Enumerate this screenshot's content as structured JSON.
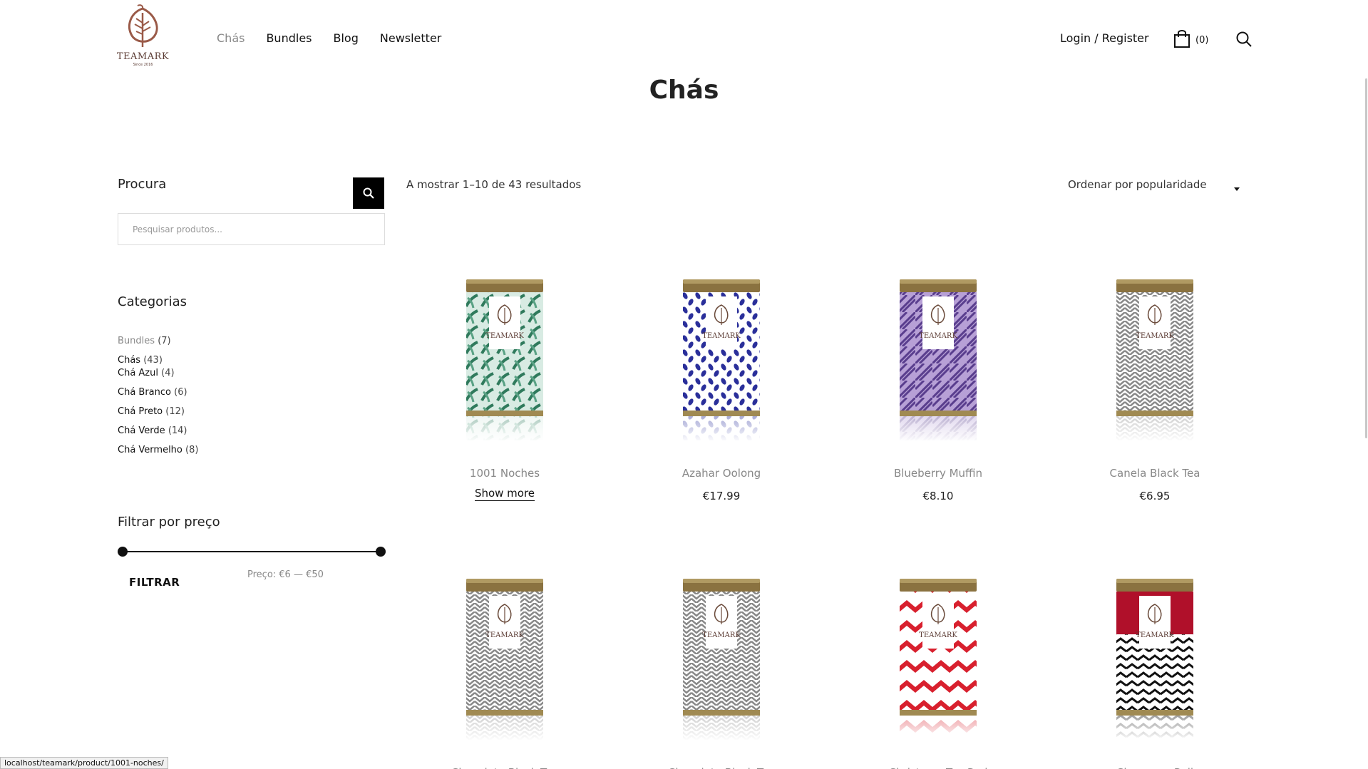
{
  "brand": {
    "name": "TEAMARK",
    "tagline": "Since 2016"
  },
  "nav": {
    "items": [
      "Chás",
      "Bundles",
      "Blog",
      "Newsletter"
    ],
    "active": "Chás"
  },
  "header": {
    "login": "Login / Register",
    "cart_count": "(0)"
  },
  "page": {
    "title": "Chás"
  },
  "sidebar": {
    "search_title": "Procura",
    "search_placeholder": "Pesquisar produtos...",
    "categories_title": "Categorias",
    "categories": [
      {
        "name": "Bundles",
        "count": "(7)"
      },
      {
        "name": "Chás",
        "count": "(43)"
      },
      {
        "name": "Chá Azul",
        "count": "(4)"
      },
      {
        "name": "Chá Branco",
        "count": "(6)"
      },
      {
        "name": "Chá Preto",
        "count": "(12)"
      },
      {
        "name": "Chá Verde",
        "count": "(14)"
      },
      {
        "name": "Chá Vermelho",
        "count": "(8)"
      }
    ],
    "price_title": "Filtrar por preço",
    "filter_button": "FILTRAR",
    "price_range": "Preço: €6 — €50"
  },
  "shop": {
    "result_count": "A mostrar 1–10 de 43 resultados",
    "orderby": "Ordenar por popularidade",
    "show_more": "Show more",
    "products": [
      {
        "name": "1001 Noches",
        "price": "",
        "pattern": "leaves-green"
      },
      {
        "name": "Azahar Oolong",
        "price": "€17.99",
        "pattern": "leaves-blue"
      },
      {
        "name": "Blueberry Muffin",
        "price": "€8.10",
        "pattern": "palms-purple"
      },
      {
        "name": "Canela Black Tea",
        "price": "€6.95",
        "pattern": "herringbone-grey"
      },
      {
        "name": "Chocolate Black Tea",
        "price": "",
        "pattern": "herringbone-grey"
      },
      {
        "name": "Chocolate Black Tea",
        "price": "",
        "pattern": "herringbone-grey"
      },
      {
        "name": "Christmas Tea Red",
        "price": "",
        "pattern": "chevron-red"
      },
      {
        "name": "Cinnamon Roll",
        "price": "",
        "pattern": "chevron-black"
      }
    ]
  },
  "status_url": "localhost/teamark/product/1001-noches/",
  "colors": {
    "brand": "#8a4a3a",
    "lid": "#8a7240",
    "text": "#222222"
  }
}
